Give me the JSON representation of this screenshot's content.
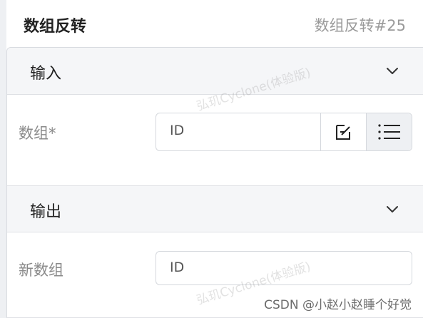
{
  "header": {
    "title": "数组反转",
    "node_id": "数组反转#25"
  },
  "input_section": {
    "title": "输入",
    "field_label": "数组*",
    "field_value": "ID",
    "edit_icon": "edit-icon",
    "list_icon": "list-icon"
  },
  "output_section": {
    "title": "输出",
    "field_label": "新数组",
    "field_value": "ID"
  },
  "watermark": "弘玑Cyclone(体验版)",
  "csdn_credit": "CSDN @小赵小赵睡个好觉",
  "colors": {
    "header_bg": "#ffffff",
    "section_bg": "#f5f6f8",
    "border": "#d5d8dd",
    "label": "#8a8a8a"
  }
}
